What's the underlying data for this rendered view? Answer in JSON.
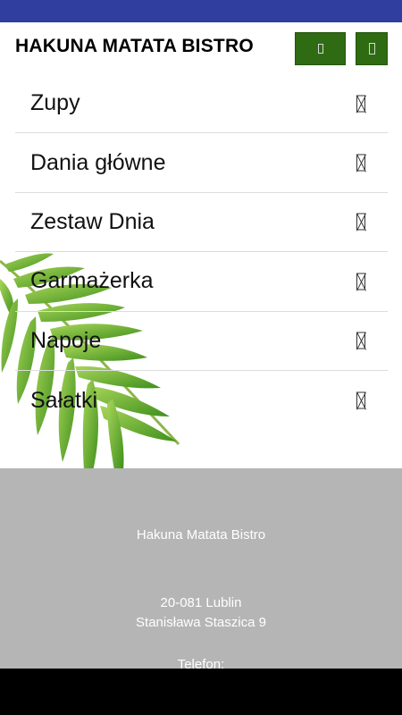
{
  "header": {
    "title": "HAKUNA MATATA BISTRO",
    "button_primary_icon": "missing-glyph-icon",
    "button_secondary_icon": "missing-glyph-icon",
    "button_color": "#2e6b12"
  },
  "menu": {
    "items": [
      {
        "label": "Zupy",
        "icon": "missing-glyph-icon"
      },
      {
        "label": "Dania główne",
        "icon": "missing-glyph-icon"
      },
      {
        "label": "Zestaw Dnia",
        "icon": "missing-glyph-icon"
      },
      {
        "label": "Garmażerka",
        "icon": "missing-glyph-icon"
      },
      {
        "label": "Napoje",
        "icon": "missing-glyph-icon"
      },
      {
        "label": "Sałatki",
        "icon": "missing-glyph-icon"
      }
    ]
  },
  "footer": {
    "name": "Hakuna Matata Bistro",
    "postal": "20-081 Lublin",
    "street": "Stanisława Staszica 9",
    "phone_label": "Telefon:",
    "background": "#b5b5b5"
  },
  "colors": {
    "status_bar": "#303f9f",
    "nav_bar": "#000000"
  }
}
